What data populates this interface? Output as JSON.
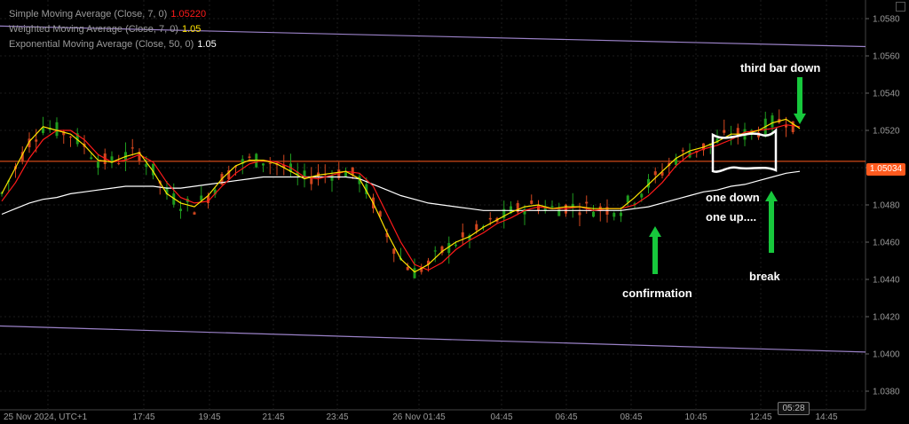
{
  "legend": [
    {
      "label": "Simple Moving Average (Close, 7, 0)",
      "value": "1.05220",
      "color": "#ff1a1a"
    },
    {
      "label": "Weighted Moving Average (Close, 7, 0)",
      "value": "1.05",
      "color": "#ffe400"
    },
    {
      "label": "Exponential Moving Average (Close, 50, 0)",
      "value": "1.05",
      "color": "#ffffff"
    }
  ],
  "price_label": "1.05034",
  "time_badge": "05:28",
  "annotations": {
    "third_bar_down": "third bar down",
    "one_down": "one down",
    "one_up": "one up....",
    "break": "break",
    "confirmation": "confirmation"
  },
  "colors": {
    "background": "#000000",
    "up_candle": "#1e9b1e",
    "down_candle": "#d2461e",
    "price_line": "#ff5a1e",
    "channel": "#9b82c8",
    "arrow": "#17c83c",
    "sma": "#ff1a1a",
    "wma": "#ffe400",
    "ema": "#ffffff"
  },
  "chart_data": {
    "type": "line",
    "title": "",
    "ylabel": "",
    "ylim": [
      1.037,
      1.059
    ],
    "y_ticks": [
      "1.0380",
      "1.0400",
      "1.0420",
      "1.0440",
      "1.0460",
      "1.0480",
      "1.0500",
      "1.0520",
      "1.0540",
      "1.0560",
      "1.0580"
    ],
    "x_ticks": [
      "25 Nov 2024, UTC+1",
      "17:45",
      "19:45",
      "21:45",
      "23:45",
      "26 Nov 01:45",
      "04:45",
      "06:45",
      "08:45",
      "10:45",
      "12:45",
      "14:45"
    ],
    "current_price": 1.05034,
    "series": [
      {
        "name": "Simple Moving Average (Close, 7, 0)",
        "values": [
          1.0482,
          1.0492,
          1.0505,
          1.0515,
          1.052,
          1.052,
          1.0515,
          1.0507,
          1.0503,
          1.0504,
          1.0507,
          1.0503,
          1.0492,
          1.0484,
          1.0481,
          1.0482,
          1.049,
          1.0497,
          1.0502,
          1.0504,
          1.0503,
          1.05,
          1.0495,
          1.0494,
          1.0496,
          1.0498,
          1.0497,
          1.049,
          1.0475,
          1.046,
          1.0448,
          1.0445,
          1.0449,
          1.0456,
          1.0461,
          1.0465,
          1.047,
          1.0473,
          1.0477,
          1.0479,
          1.0478,
          1.0478,
          1.0479,
          1.0477,
          1.0478,
          1.0478,
          1.048,
          1.0485,
          1.0492,
          1.0501,
          1.0507,
          1.051,
          1.0512,
          1.0515,
          1.0519,
          1.052,
          1.0521,
          1.0523,
          1.0522
        ]
      },
      {
        "name": "Weighted Moving Average (Close, 7, 0)",
        "values": [
          1.0486,
          1.05,
          1.0514,
          1.0522,
          1.052,
          1.0518,
          1.0512,
          1.0504,
          1.0503,
          1.0506,
          1.0508,
          1.0498,
          1.0486,
          1.0481,
          1.0479,
          1.0485,
          1.0494,
          1.0501,
          1.0504,
          1.0504,
          1.0502,
          1.0498,
          1.0494,
          1.0496,
          1.0497,
          1.0498,
          1.0494,
          1.0481,
          1.0465,
          1.0451,
          1.0444,
          1.0448,
          1.0455,
          1.046,
          1.0463,
          1.0468,
          1.0472,
          1.0476,
          1.0479,
          1.048,
          1.0478,
          1.0479,
          1.0479,
          1.0478,
          1.0478,
          1.0478,
          1.0484,
          1.0491,
          1.0498,
          1.0505,
          1.0509,
          1.0511,
          1.0514,
          1.0518,
          1.0518,
          1.052,
          1.0524,
          1.0526,
          1.0521
        ]
      },
      {
        "name": "Exponential Moving Average (Close, 50, 0)",
        "values": [
          1.0475,
          1.0478,
          1.0481,
          1.0483,
          1.0484,
          1.0486,
          1.0487,
          1.0488,
          1.0489,
          1.049,
          1.049,
          1.049,
          1.0489,
          1.0489,
          1.049,
          1.0491,
          1.0492,
          1.0493,
          1.0494,
          1.0495,
          1.0495,
          1.0495,
          1.0495,
          1.0495,
          1.0495,
          1.0495,
          1.0494,
          1.0491,
          1.0488,
          1.0485,
          1.0483,
          1.0481,
          1.048,
          1.0479,
          1.0478,
          1.0477,
          1.0477,
          1.0477,
          1.0477,
          1.0477,
          1.0477,
          1.0477,
          1.0477,
          1.0477,
          1.0477,
          1.0477,
          1.0478,
          1.0479,
          1.0481,
          1.0483,
          1.0485,
          1.0487,
          1.0488,
          1.049,
          1.0491,
          1.0493,
          1.0495,
          1.0497,
          1.0498
        ]
      },
      {
        "name": "Channel upper",
        "values": [
          1.0576,
          1.0565
        ]
      },
      {
        "name": "Channel lower",
        "values": [
          1.0415,
          1.0401
        ]
      }
    ]
  }
}
